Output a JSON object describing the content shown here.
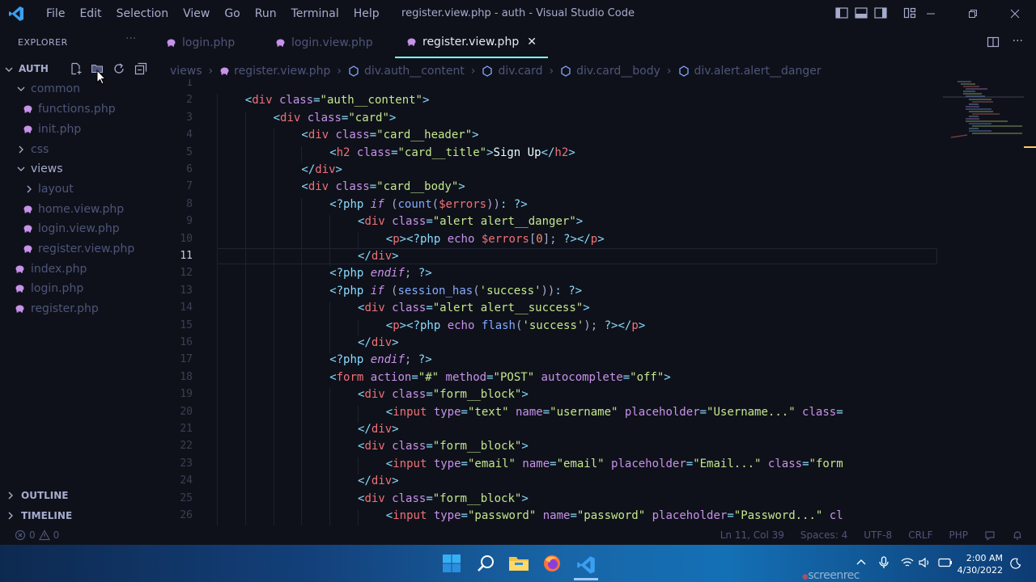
{
  "window": {
    "title": "register.view.php - auth - Visual Studio Code",
    "menu": [
      "File",
      "Edit",
      "Selection",
      "View",
      "Go",
      "Run",
      "Terminal",
      "Help"
    ]
  },
  "explorer": {
    "title": "EXPLORER",
    "more": "···",
    "folder": "AUTH",
    "items": [
      {
        "label": "common",
        "kind": "folder-open",
        "depth": 1
      },
      {
        "label": "functions.php",
        "kind": "php",
        "depth": 2
      },
      {
        "label": "init.php",
        "kind": "php",
        "depth": 2
      },
      {
        "label": "css",
        "kind": "folder",
        "depth": 1
      },
      {
        "label": "views",
        "kind": "folder-open",
        "depth": 1
      },
      {
        "label": "layout",
        "kind": "folder",
        "depth": 2
      },
      {
        "label": "home.view.php",
        "kind": "php",
        "depth": 2
      },
      {
        "label": "login.view.php",
        "kind": "php",
        "depth": 2
      },
      {
        "label": "register.view.php",
        "kind": "php",
        "depth": 2
      },
      {
        "label": "index.php",
        "kind": "php",
        "depth": 1
      },
      {
        "label": "login.php",
        "kind": "php",
        "depth": 1
      },
      {
        "label": "register.php",
        "kind": "php",
        "depth": 1
      }
    ],
    "outline": "OUTLINE",
    "timeline": "TIMELINE"
  },
  "tabs": [
    {
      "label": "login.php",
      "active": false
    },
    {
      "label": "login.view.php",
      "active": false
    },
    {
      "label": "register.view.php",
      "active": true
    }
  ],
  "breadcrumb": [
    "views",
    "register.view.php",
    "div.auth__content",
    "div.card",
    "div.card__body",
    "div.alert.alert__danger"
  ],
  "editor": {
    "current_line": 11,
    "lines": [
      {
        "n": "1",
        "indent": 0,
        "t": []
      },
      {
        "n": "2",
        "indent": 4,
        "t": [
          [
            "br",
            "<"
          ],
          [
            "tag",
            "div"
          ],
          [
            "attr",
            " class"
          ],
          [
            "br",
            "="
          ],
          [
            "str",
            "\"auth__content\""
          ],
          [
            "br",
            ">"
          ]
        ]
      },
      {
        "n": "3",
        "indent": 8,
        "t": [
          [
            "br",
            "<"
          ],
          [
            "tag",
            "div"
          ],
          [
            "attr",
            " class"
          ],
          [
            "br",
            "="
          ],
          [
            "str",
            "\"card\""
          ],
          [
            "br",
            ">"
          ]
        ]
      },
      {
        "n": "4",
        "indent": 12,
        "t": [
          [
            "br",
            "<"
          ],
          [
            "tag",
            "div"
          ],
          [
            "attr",
            " class"
          ],
          [
            "br",
            "="
          ],
          [
            "str",
            "\"card__header\""
          ],
          [
            "br",
            ">"
          ]
        ]
      },
      {
        "n": "5",
        "indent": 16,
        "t": [
          [
            "br",
            "<"
          ],
          [
            "tag",
            "h2"
          ],
          [
            "attr",
            " class"
          ],
          [
            "br",
            "="
          ],
          [
            "str",
            "\"card__title\""
          ],
          [
            "br",
            ">"
          ],
          [
            "txt",
            "Sign Up"
          ],
          [
            "br",
            "</"
          ],
          [
            "tag",
            "h2"
          ],
          [
            "br",
            ">"
          ]
        ]
      },
      {
        "n": "6",
        "indent": 12,
        "t": [
          [
            "br",
            "</"
          ],
          [
            "tag",
            "div"
          ],
          [
            "br",
            ">"
          ]
        ]
      },
      {
        "n": "7",
        "indent": 12,
        "t": [
          [
            "br",
            "<"
          ],
          [
            "tag",
            "div"
          ],
          [
            "attr",
            " class"
          ],
          [
            "br",
            "="
          ],
          [
            "str",
            "\"card__body\""
          ],
          [
            "br",
            ">"
          ]
        ]
      },
      {
        "n": "8",
        "indent": 16,
        "t": [
          [
            "br",
            "<?php "
          ],
          [
            "kw",
            "if"
          ],
          [
            "pl",
            " ("
          ],
          [
            "fn",
            "count"
          ],
          [
            "pl",
            "("
          ],
          [
            "var",
            "$errors"
          ],
          [
            "pl",
            "))"
          ],
          [
            "br",
            ": ?>"
          ]
        ]
      },
      {
        "n": "9",
        "indent": 20,
        "t": [
          [
            "br",
            "<"
          ],
          [
            "tag",
            "div"
          ],
          [
            "attr",
            " class"
          ],
          [
            "br",
            "="
          ],
          [
            "str",
            "\"alert alert__danger\""
          ],
          [
            "br",
            ">"
          ]
        ]
      },
      {
        "n": "10",
        "indent": 24,
        "t": [
          [
            "br",
            "<"
          ],
          [
            "tag",
            "p"
          ],
          [
            "br",
            "><?php "
          ],
          [
            "attr",
            "echo "
          ],
          [
            "var",
            "$errors"
          ],
          [
            "pl",
            "["
          ],
          [
            "num",
            "0"
          ],
          [
            "pl",
            "]; "
          ],
          [
            "br",
            "?></"
          ],
          [
            "tag",
            "p"
          ],
          [
            "br",
            ">"
          ]
        ]
      },
      {
        "n": "11",
        "indent": 20,
        "t": [
          [
            "br",
            "</"
          ],
          [
            "tag",
            "div"
          ],
          [
            "br",
            ">"
          ]
        ]
      },
      {
        "n": "12",
        "indent": 16,
        "t": [
          [
            "br",
            "<?php "
          ],
          [
            "kw",
            "endif"
          ],
          [
            "pl",
            "; "
          ],
          [
            "br",
            "?>"
          ]
        ]
      },
      {
        "n": "13",
        "indent": 16,
        "t": [
          [
            "br",
            "<?php "
          ],
          [
            "kw",
            "if"
          ],
          [
            "pl",
            " ("
          ],
          [
            "fn",
            "session_has"
          ],
          [
            "pl",
            "("
          ],
          [
            "str",
            "'success'"
          ],
          [
            "pl",
            "))"
          ],
          [
            "br",
            ": ?>"
          ]
        ]
      },
      {
        "n": "14",
        "indent": 20,
        "t": [
          [
            "br",
            "<"
          ],
          [
            "tag",
            "div"
          ],
          [
            "attr",
            " class"
          ],
          [
            "br",
            "="
          ],
          [
            "str",
            "\"alert alert__success\""
          ],
          [
            "br",
            ">"
          ]
        ]
      },
      {
        "n": "15",
        "indent": 24,
        "t": [
          [
            "br",
            "<"
          ],
          [
            "tag",
            "p"
          ],
          [
            "br",
            "><?php "
          ],
          [
            "attr",
            "echo "
          ],
          [
            "fn",
            "flash"
          ],
          [
            "pl",
            "("
          ],
          [
            "str",
            "'success'"
          ],
          [
            "pl",
            "); "
          ],
          [
            "br",
            "?></"
          ],
          [
            "tag",
            "p"
          ],
          [
            "br",
            ">"
          ]
        ]
      },
      {
        "n": "16",
        "indent": 20,
        "t": [
          [
            "br",
            "</"
          ],
          [
            "tag",
            "div"
          ],
          [
            "br",
            ">"
          ]
        ]
      },
      {
        "n": "17",
        "indent": 16,
        "t": [
          [
            "br",
            "<?php "
          ],
          [
            "kw",
            "endif"
          ],
          [
            "pl",
            "; "
          ],
          [
            "br",
            "?>"
          ]
        ]
      },
      {
        "n": "18",
        "indent": 16,
        "t": [
          [
            "br",
            "<"
          ],
          [
            "tag",
            "form"
          ],
          [
            "attr",
            " action"
          ],
          [
            "br",
            "="
          ],
          [
            "str",
            "\"#\""
          ],
          [
            "attr",
            " method"
          ],
          [
            "br",
            "="
          ],
          [
            "str",
            "\"POST\""
          ],
          [
            "attr",
            " autocomplete"
          ],
          [
            "br",
            "="
          ],
          [
            "str",
            "\"off\""
          ],
          [
            "br",
            ">"
          ]
        ]
      },
      {
        "n": "19",
        "indent": 20,
        "t": [
          [
            "br",
            "<"
          ],
          [
            "tag",
            "div"
          ],
          [
            "attr",
            " class"
          ],
          [
            "br",
            "="
          ],
          [
            "str",
            "\"form__block\""
          ],
          [
            "br",
            ">"
          ]
        ]
      },
      {
        "n": "20",
        "indent": 24,
        "t": [
          [
            "br",
            "<"
          ],
          [
            "tag",
            "input"
          ],
          [
            "attr",
            " type"
          ],
          [
            "br",
            "="
          ],
          [
            "str",
            "\"text\""
          ],
          [
            "attr",
            " name"
          ],
          [
            "br",
            "="
          ],
          [
            "str",
            "\"username\""
          ],
          [
            "attr",
            " placeholder"
          ],
          [
            "br",
            "="
          ],
          [
            "str",
            "\"Username...\""
          ],
          [
            "attr",
            " class"
          ],
          [
            "br",
            "="
          ]
        ]
      },
      {
        "n": "21",
        "indent": 20,
        "t": [
          [
            "br",
            "</"
          ],
          [
            "tag",
            "div"
          ],
          [
            "br",
            ">"
          ]
        ]
      },
      {
        "n": "22",
        "indent": 20,
        "t": [
          [
            "br",
            "<"
          ],
          [
            "tag",
            "div"
          ],
          [
            "attr",
            " class"
          ],
          [
            "br",
            "="
          ],
          [
            "str",
            "\"form__block\""
          ],
          [
            "br",
            ">"
          ]
        ]
      },
      {
        "n": "23",
        "indent": 24,
        "t": [
          [
            "br",
            "<"
          ],
          [
            "tag",
            "input"
          ],
          [
            "attr",
            " type"
          ],
          [
            "br",
            "="
          ],
          [
            "str",
            "\"email\""
          ],
          [
            "attr",
            " name"
          ],
          [
            "br",
            "="
          ],
          [
            "str",
            "\"email\""
          ],
          [
            "attr",
            " placeholder"
          ],
          [
            "br",
            "="
          ],
          [
            "str",
            "\"Email...\""
          ],
          [
            "attr",
            " class"
          ],
          [
            "br",
            "="
          ],
          [
            "str",
            "\"form"
          ]
        ]
      },
      {
        "n": "24",
        "indent": 20,
        "t": [
          [
            "br",
            "</"
          ],
          [
            "tag",
            "div"
          ],
          [
            "br",
            ">"
          ]
        ]
      },
      {
        "n": "25",
        "indent": 20,
        "t": [
          [
            "br",
            "<"
          ],
          [
            "tag",
            "div"
          ],
          [
            "attr",
            " class"
          ],
          [
            "br",
            "="
          ],
          [
            "str",
            "\"form__block\""
          ],
          [
            "br",
            ">"
          ]
        ]
      },
      {
        "n": "26",
        "indent": 24,
        "t": [
          [
            "br",
            "<"
          ],
          [
            "tag",
            "input"
          ],
          [
            "attr",
            " type"
          ],
          [
            "br",
            "="
          ],
          [
            "str",
            "\"password\""
          ],
          [
            "attr",
            " name"
          ],
          [
            "br",
            "="
          ],
          [
            "str",
            "\"password\""
          ],
          [
            "attr",
            " placeholder"
          ],
          [
            "br",
            "="
          ],
          [
            "str",
            "\"Password...\""
          ],
          [
            "attr",
            " cl"
          ]
        ]
      }
    ]
  },
  "status": {
    "errors": "0",
    "warnings": "0",
    "position": "Ln 11, Col 39",
    "spaces": "Spaces: 4",
    "encoding": "UTF-8",
    "eol": "CRLF",
    "language": "PHP"
  },
  "taskbar": {
    "time": "2:00 AM",
    "date": "4/30/2022",
    "watermark": "screenrec"
  },
  "colors": {
    "background": "#0f111a",
    "accent": "#84ffff",
    "php_icon": "#c792ea"
  }
}
